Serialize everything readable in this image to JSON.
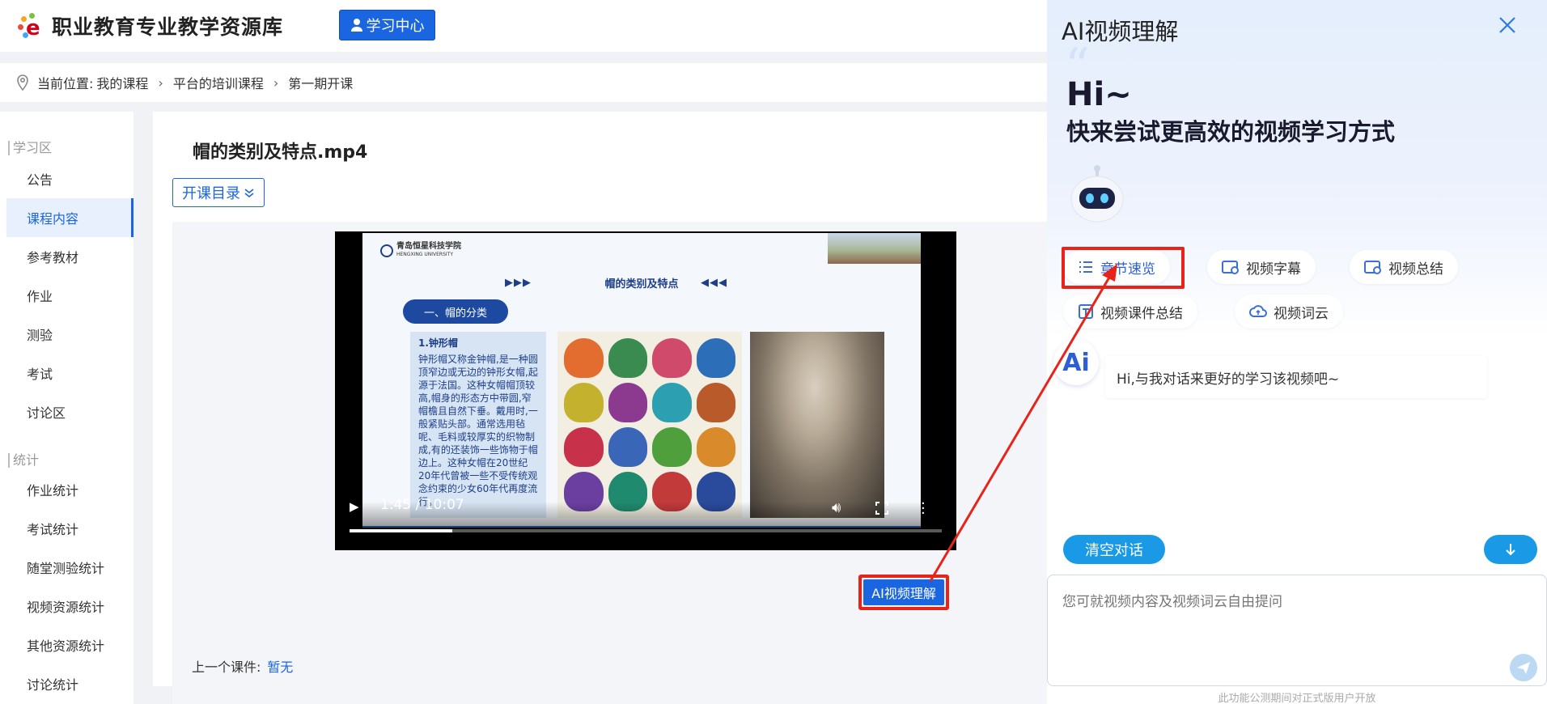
{
  "header": {
    "site_title": "职业教育专业教学资源库",
    "learn_center_label": "学习中心"
  },
  "breadcrumb": {
    "prefix": "当前位置:",
    "items": [
      "我的课程",
      "平台的培训课程",
      "第一期开课"
    ]
  },
  "sidebar": {
    "sections": [
      {
        "title": "学习区",
        "items": [
          "公告",
          "课程内容",
          "参考教材",
          "作业",
          "测验",
          "考试",
          "讨论区"
        ]
      },
      {
        "title": "统计",
        "items": [
          "作业统计",
          "考试统计",
          "随堂测验统计",
          "视频资源统计",
          "其他资源统计",
          "讨论统计"
        ]
      }
    ],
    "active_item": "课程内容"
  },
  "main": {
    "video_title": "帽的类别及特点.mp4",
    "catalog_label": "开课目录",
    "ai_button_label": "AI视频理解",
    "prev_label": "上一个课件:",
    "prev_value": "暂无"
  },
  "video": {
    "slide_school_name": "青岛恒星科技学院",
    "slide_school_en": "HENGXING UNIVERSITY",
    "slide_heading": "帽的类别及特点",
    "slide_section": "一、帽的分类",
    "slide_text_heading": "1.钟形帽",
    "slide_text_body": "钟形帽又称金钟帽,是一种圆顶窄边或无边的钟形女帽,起源于法国。这种女帽帽顶较高,帽身的形态方中带圆,窄帽檐且自然下垂。戴用时,一般紧贴头部。通常选用毡呢、毛料或较厚实的织物制成,有的还装饰一些饰物于帽边上。这种女帽在20世纪20年代曾被一些不受传统观念约束的少女60年代再度流行。",
    "current_time": "1:45",
    "duration": "10:07",
    "progress_fraction": 0.173
  },
  "ai_panel": {
    "title": "AI视频理解",
    "greeting": "Hi~",
    "slogan": "快来尝试更高效的视频学习方式",
    "chips": [
      "章节速览",
      "视频字幕",
      "视频总结",
      "视频课件总结",
      "视频词云"
    ],
    "assistant_message": "Hi,与我对话来更好的学习该视频吧~",
    "clear_label": "清空对话",
    "input_placeholder": "您可就视频内容及视频词云自由提问",
    "footer_note": "此功能公测期间对正式版用户开放",
    "accent_color": "#1a9ae6",
    "highlight_color": "#e8231a"
  }
}
